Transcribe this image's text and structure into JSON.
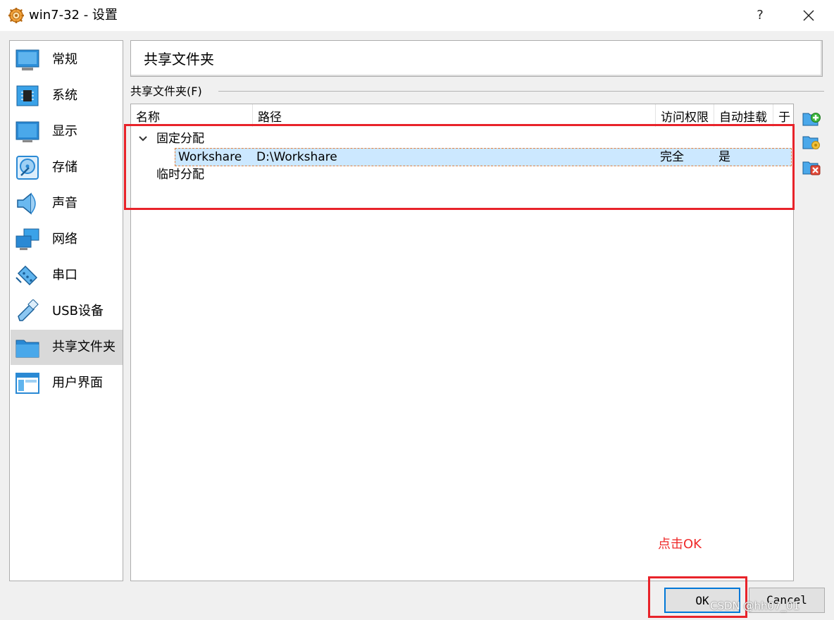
{
  "window": {
    "title": "win7-32 - 设置",
    "help_label": "?"
  },
  "sidebar": {
    "items": [
      {
        "label": "常规",
        "icon": "general-icon"
      },
      {
        "label": "系统",
        "icon": "chip-icon"
      },
      {
        "label": "显示",
        "icon": "monitor-icon"
      },
      {
        "label": "存储",
        "icon": "disk-icon"
      },
      {
        "label": "声音",
        "icon": "speaker-icon"
      },
      {
        "label": "网络",
        "icon": "network-icon"
      },
      {
        "label": "串口",
        "icon": "serial-port-icon"
      },
      {
        "label": "USB设备",
        "icon": "usb-icon"
      },
      {
        "label": "共享文件夹",
        "icon": "folder-icon",
        "selected": true
      },
      {
        "label": "用户界面",
        "icon": "user-interface-icon"
      }
    ]
  },
  "main": {
    "page_title": "共享文件夹",
    "group_label": "共享文件夹(F)",
    "table": {
      "columns": [
        "名称",
        "路径",
        "访问权限",
        "自动挂载",
        "于"
      ],
      "groups": [
        {
          "label": "固定分配",
          "expanded": true,
          "rows": [
            {
              "name": "Workshare",
              "path": "D:\\Workshare",
              "access": "完全",
              "automount": "是",
              "at": ""
            }
          ]
        },
        {
          "label": "临时分配",
          "expanded": false,
          "rows": []
        }
      ]
    },
    "side_buttons": [
      "add-folder-icon",
      "edit-folder-icon",
      "remove-folder-icon"
    ]
  },
  "annotation": {
    "text": "点击OK",
    "color": "#e8232a"
  },
  "buttons": {
    "ok": "OK",
    "cancel": "Cancel"
  },
  "watermark": "CSDN @hh07_01",
  "colors": {
    "selection": "#cce8ff",
    "accent": "#0078d7",
    "highlight": "#e8232a"
  }
}
